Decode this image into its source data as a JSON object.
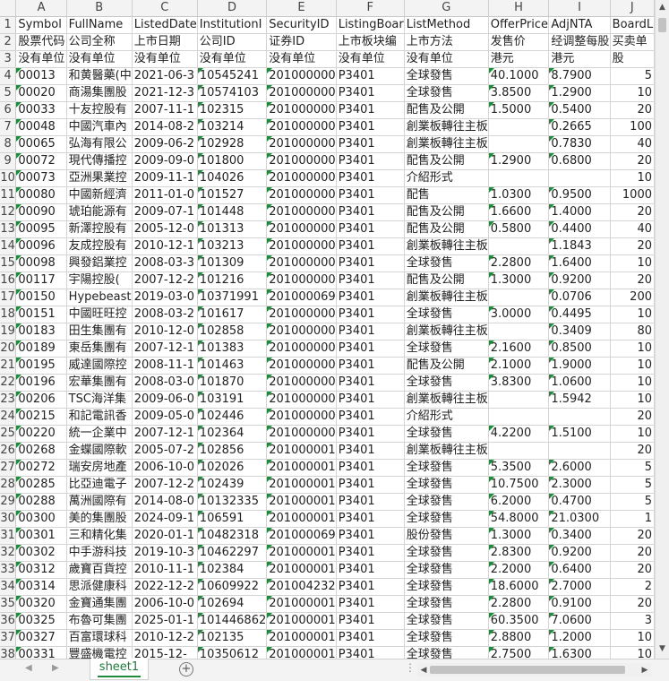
{
  "columns": [
    "A",
    "B",
    "C",
    "D",
    "E",
    "F",
    "G",
    "H",
    "I",
    "J"
  ],
  "rows": [
    [
      "Symbol",
      "FullName",
      "ListedDate",
      "InstitutionI",
      "SecurityID",
      "ListingBoar",
      "ListMethod",
      "OfferPrice",
      "AdjNTA",
      "BoardL"
    ],
    [
      "股票代码",
      "公司全称",
      "上市日期",
      "公司ID",
      "证券ID",
      "上市板块编",
      "上市方法",
      "发售价",
      "经调整每股",
      "买卖单"
    ],
    [
      "没有单位",
      "没有单位",
      "没有单位",
      "没有单位",
      "没有单位",
      "没有单位",
      "没有单位",
      "港元",
      "港元",
      "股"
    ],
    [
      "00013",
      "和黄醫藥(中",
      "2021-06-3",
      "10545241",
      "201000000",
      "P3401",
      "全球發售",
      "40.1000",
      "8.7900",
      "5"
    ],
    [
      "00020",
      "商湯集團股",
      "2021-12-3",
      "10574103",
      "201000000",
      "P3401",
      "全球發售",
      "3.8500",
      "1.2900",
      "10"
    ],
    [
      "00033",
      "十友控股有",
      "2007-11-1",
      "102315",
      "201000000",
      "P3401",
      "配售及公開",
      "1.5000",
      "0.5400",
      "20"
    ],
    [
      "00048",
      "中國汽車內",
      "2014-08-2",
      "103214",
      "201000000",
      "P3401",
      "創業板轉往主板",
      "",
      "0.2665",
      "100"
    ],
    [
      "00065",
      "弘海有限公",
      "2009-06-2",
      "102928",
      "201000000",
      "P3401",
      "創業板轉往主板",
      "",
      "0.7830",
      "40"
    ],
    [
      "00072",
      "現代傳播控",
      "2009-09-0",
      "101800",
      "201000000",
      "P3401",
      "配售及公開",
      "1.2900",
      "0.6800",
      "20"
    ],
    [
      "00073",
      "亞洲果業控",
      "2009-11-1",
      "104026",
      "201000000",
      "P3401",
      "介紹形式",
      "",
      "",
      "10"
    ],
    [
      "00080",
      "中國新經濟",
      "2011-01-0",
      "101527",
      "201000000",
      "P3401",
      "配售",
      "1.0300",
      "0.9500",
      "1000"
    ],
    [
      "00090",
      "琥珀能源有",
      "2009-07-1",
      "101448",
      "201000000",
      "P3401",
      "配售及公開",
      "1.6600",
      "1.4000",
      "20"
    ],
    [
      "00095",
      "新澤控股有",
      "2005-12-0",
      "101313",
      "201000000",
      "P3401",
      "配售及公開",
      "0.5800",
      "0.4400",
      "40"
    ],
    [
      "00096",
      "友成控股有",
      "2010-12-1",
      "103213",
      "201000000",
      "P3401",
      "創業板轉往主板",
      "",
      "1.1843",
      "20"
    ],
    [
      "00098",
      "興發鋁業控",
      "2008-03-3",
      "101309",
      "201000000",
      "P3401",
      "全球發售",
      "2.2800",
      "1.6400",
      "10"
    ],
    [
      "00117",
      "宇陽控股(",
      "2007-12-2",
      "101216",
      "201000000",
      "P3401",
      "配售及公開",
      "1.3000",
      "0.9200",
      "20"
    ],
    [
      "00150",
      "Hypebeast",
      "2019-03-0",
      "10371991",
      "201000069",
      "P3401",
      "創業板轉往主板",
      "",
      "0.0706",
      "200"
    ],
    [
      "00151",
      "中國旺旺控",
      "2008-03-2",
      "101617",
      "201000000",
      "P3401",
      "全球發售",
      "3.0000",
      "0.4495",
      "10"
    ],
    [
      "00183",
      "田生集團有",
      "2010-12-0",
      "102858",
      "201000000",
      "P3401",
      "創業板轉往主板",
      "",
      "0.3409",
      "80"
    ],
    [
      "00189",
      "東岳集團有",
      "2007-12-1",
      "101383",
      "201000000",
      "P3401",
      "全球發售",
      "2.1600",
      "0.8500",
      "10"
    ],
    [
      "00195",
      "威達國際控",
      "2008-11-1",
      "101463",
      "201000000",
      "P3401",
      "配售及公開",
      "2.1000",
      "1.9000",
      "10"
    ],
    [
      "00196",
      "宏華集團有",
      "2008-03-0",
      "101870",
      "201000000",
      "P3401",
      "全球發售",
      "3.8300",
      "1.0600",
      "10"
    ],
    [
      "00206",
      "TSC海洋集",
      "2009-06-0",
      "103191",
      "201000000",
      "P3401",
      "創業板轉往主板",
      "",
      "1.5942",
      "10"
    ],
    [
      "00215",
      "和記電訊香",
      "2009-05-0",
      "102446",
      "201000000",
      "P3401",
      "介紹形式",
      "",
      "",
      "20"
    ],
    [
      "00220",
      "統一企業中",
      "2007-12-1",
      "102364",
      "201000000",
      "P3401",
      "全球發售",
      "4.2200",
      "1.5100",
      "10"
    ],
    [
      "00268",
      "金蝶國際軟",
      "2005-07-2",
      "102856",
      "201000001",
      "P3401",
      "創業板轉往主板",
      "",
      "",
      "20"
    ],
    [
      "00272",
      "瑞安房地產",
      "2006-10-0",
      "102026",
      "201000001",
      "P3401",
      "全球發售",
      "5.3500",
      "2.6000",
      "5"
    ],
    [
      "00285",
      "比亞迪電子",
      "2007-12-2",
      "102439",
      "201000001",
      "P3401",
      "全球發售",
      "10.7500",
      "2.3000",
      "5"
    ],
    [
      "00288",
      "萬洲國際有",
      "2014-08-0",
      "10132335",
      "201000001",
      "P3401",
      "全球發售",
      "6.2000",
      "0.4700",
      "5"
    ],
    [
      "00300",
      "美的集團股",
      "2024-09-1",
      "106591",
      "201000001",
      "P3401",
      "全球發售",
      "54.8000",
      "21.0300",
      "1"
    ],
    [
      "00301",
      "三和精化集",
      "2020-01-1",
      "10482318",
      "201000069",
      "P3401",
      "股份發售",
      "1.3000",
      "0.3400",
      "20"
    ],
    [
      "00302",
      "中手游科技",
      "2019-10-3",
      "10462297",
      "201000001",
      "P3401",
      "全球發售",
      "2.8300",
      "0.9200",
      "20"
    ],
    [
      "00312",
      "歲寶百貨控",
      "2010-11-1",
      "102384",
      "201000001",
      "P3401",
      "全球發售",
      "2.2000",
      "0.6400",
      "20"
    ],
    [
      "00314",
      "思派健康科",
      "2022-12-2",
      "10609922",
      "201004232",
      "P3401",
      "全球發售",
      "18.6000",
      "2.7000",
      "2"
    ],
    [
      "00320",
      "金寶通集團",
      "2006-10-0",
      "102694",
      "201000001",
      "P3401",
      "全球發售",
      "2.2800",
      "0.9100",
      "20"
    ],
    [
      "00325",
      "布魯可集團",
      "2025-01-1",
      "101446862",
      "201000001",
      "P3401",
      "全球發售",
      "60.3500",
      "7.0600",
      "3"
    ],
    [
      "00327",
      "百富環球科",
      "2010-12-2",
      "102135",
      "201000001",
      "P3401",
      "全球發售",
      "2.8800",
      "1.2000",
      "10"
    ],
    [
      "00331",
      "豐盛機電控",
      "2015-12-",
      "10350612",
      "201000001",
      "P3401",
      "全球發售",
      "2.7500",
      "1.6300",
      "10"
    ]
  ],
  "sheet": {
    "tab_label": "sheet1",
    "add_label": "+",
    "nav_prev": "◀",
    "nav_next": "▶",
    "dots": "⋮"
  },
  "scroll": {
    "up": "▲",
    "down": "▼",
    "left": "◀",
    "right": "▶"
  },
  "colors": {
    "accent": "#1e8a3a",
    "header_bg": "#f3f3f3",
    "grid_line": "#d4d4d4"
  }
}
